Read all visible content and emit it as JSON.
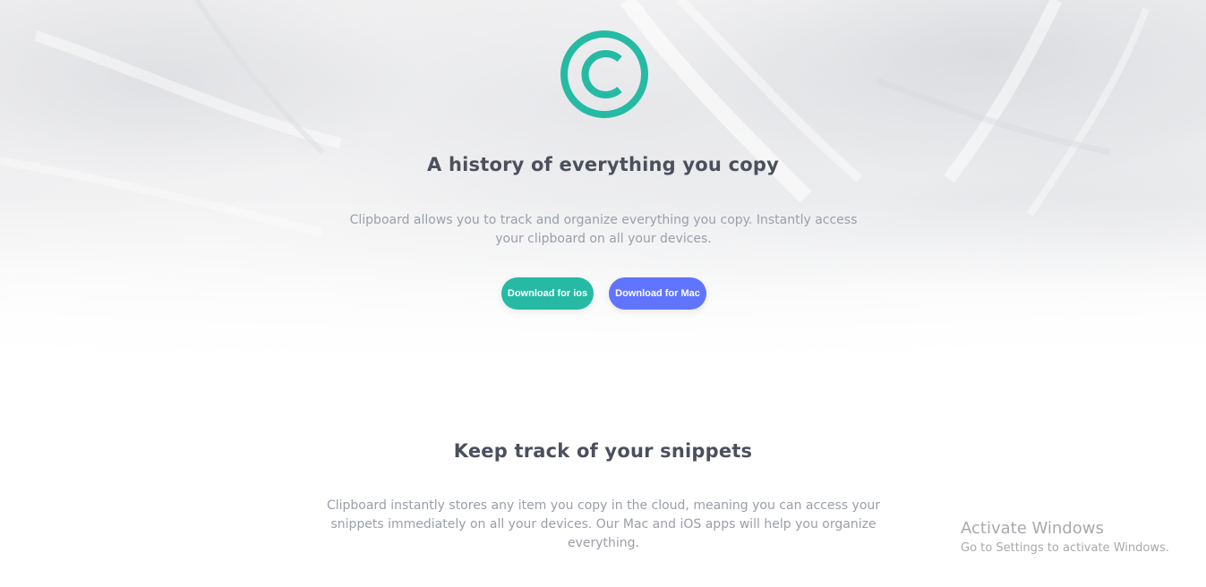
{
  "hero": {
    "title": "A history of everything you copy",
    "text": "Clipboard allows you to track and organize everything you copy. Instantly access your clipboard on all your devices.",
    "logo_icon": "copyright-logo-icon",
    "buttons": {
      "ios_label": "Download for ios",
      "mac_label": "Download for Mac"
    }
  },
  "snippets": {
    "title": "Keep track of your snippets",
    "text": "Clipboard instantly stores any item you copy in the cloud, meaning you can access your snippets immediately on all your devices. Our Mac and iOS apps will help you organize everything."
  },
  "watermark": {
    "title": "Activate Windows",
    "subtitle": "Go to Settings to activate Windows."
  },
  "colors": {
    "accent_teal": "#26baa4",
    "accent_blue": "#6174ff",
    "heading": "#4c4f5c",
    "body_text": "#9a9ea8"
  }
}
